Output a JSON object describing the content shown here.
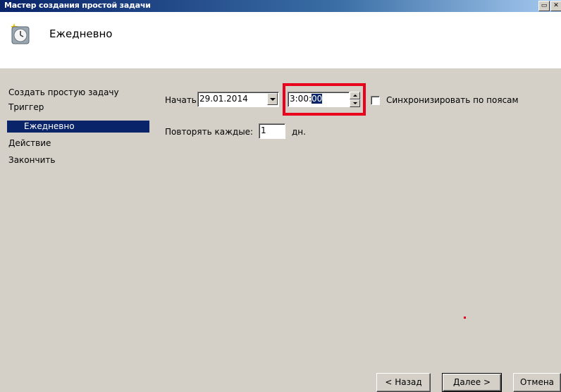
{
  "window": {
    "title": "Мастер создания простой задачи",
    "title_buttons": [
      "maximize",
      "close"
    ]
  },
  "header": {
    "title": "Ежедневно",
    "icon": "clock-icon"
  },
  "nav": {
    "items": [
      {
        "label": "Создать простую задачу",
        "selected": false
      },
      {
        "label": "Триггер",
        "selected": false
      },
      {
        "label": "Ежедневно",
        "selected": true
      },
      {
        "label": "Действие",
        "selected": false
      },
      {
        "label": "Закончить",
        "selected": false
      }
    ]
  },
  "form": {
    "start_label": "Начать:",
    "start_date": "29.01.2014",
    "start_time_prefix": "3:00:",
    "start_time_selected": "00",
    "sync_label": "Синхронизировать по поясам",
    "sync_checked": false,
    "repeat_label": "Повторять каждые:",
    "repeat_value": "1",
    "repeat_unit": "дн."
  },
  "footer": {
    "back": "< Назад",
    "next": "Далее >",
    "cancel": "Отмена"
  },
  "colors": {
    "highlight": "#e8001c",
    "selection": "#0a246a",
    "dialog_bg": "#d4d0c8"
  }
}
